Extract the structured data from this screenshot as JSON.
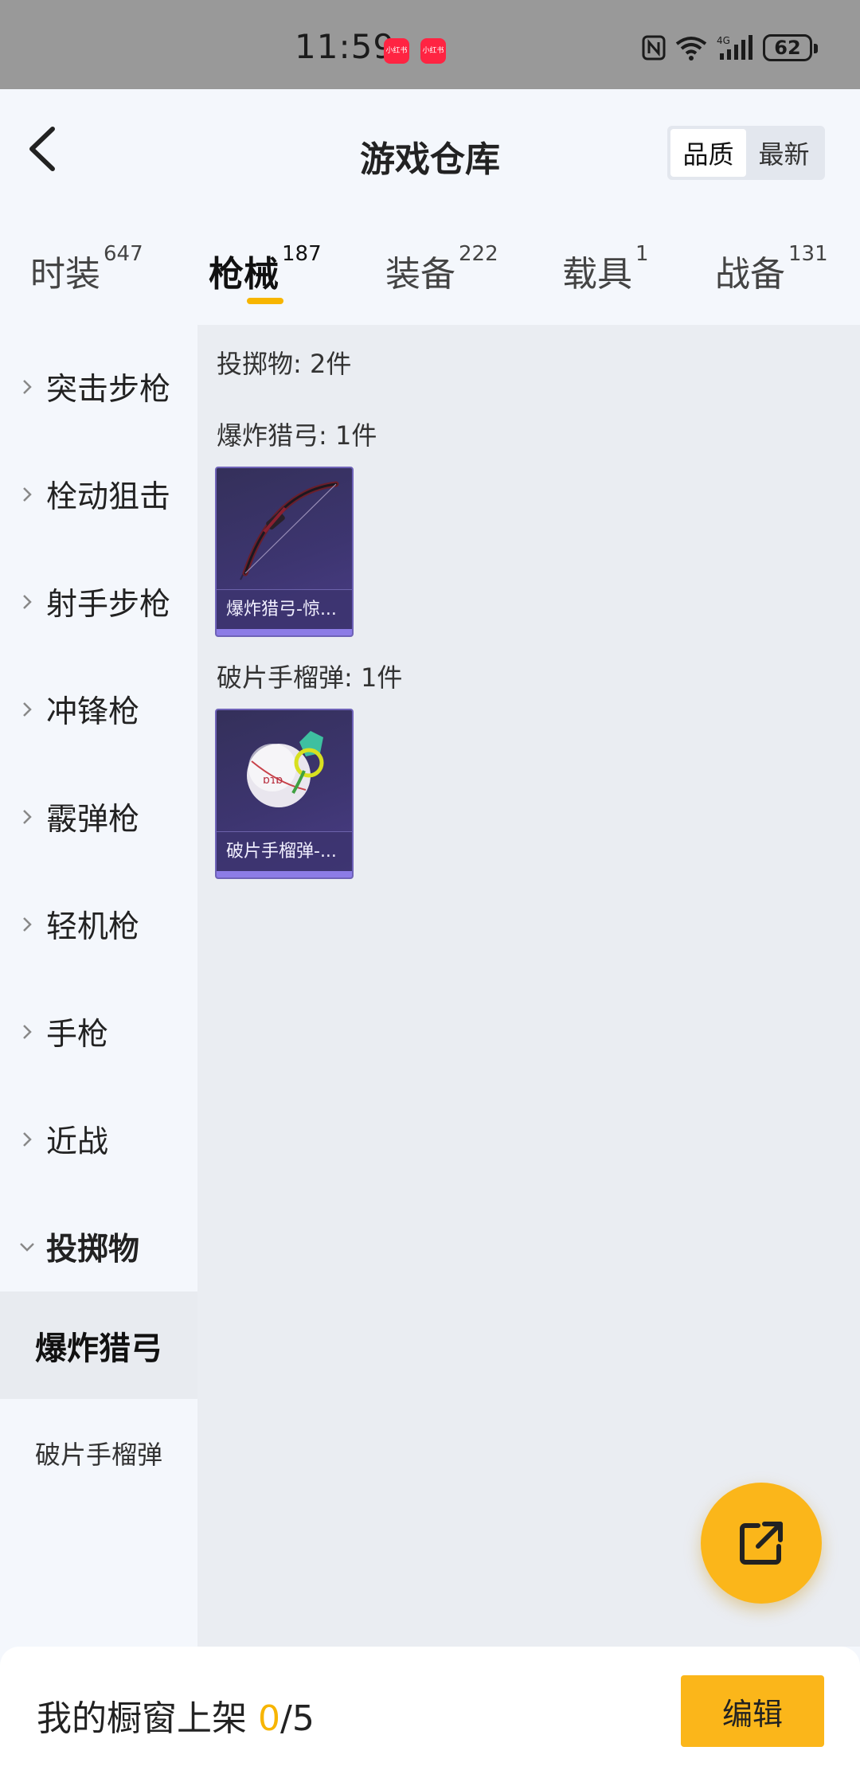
{
  "status_bar": {
    "time": "11:59",
    "notif_label_1": "小红书",
    "notif_label_2": "小红书",
    "battery": "62"
  },
  "header": {
    "title": "游戏仓库",
    "sort_options": [
      "品质",
      "最新"
    ],
    "active_sort": "品质"
  },
  "tabs": [
    {
      "label": "时装",
      "count": "647"
    },
    {
      "label": "枪械",
      "count": "187",
      "active": true
    },
    {
      "label": "装备",
      "count": "222"
    },
    {
      "label": "载具",
      "count": "1"
    },
    {
      "label": "战备",
      "count": "131"
    }
  ],
  "sidebar": {
    "categories": [
      "突击步枪",
      "栓动狙击",
      "射手步枪",
      "冲锋枪",
      "霰弹枪",
      "轻机枪",
      "手枪",
      "近战",
      "投掷物"
    ],
    "expanded_category": "投掷物",
    "sub_items": [
      "爆炸猎弓",
      "破片手榴弹"
    ],
    "selected_sub_item": "爆炸猎弓"
  },
  "content": {
    "summary": "投掷物: 2件",
    "groups": [
      {
        "label": "爆炸猎弓: 1件",
        "item_name": "爆炸猎弓-惊..."
      },
      {
        "label": "破片手榴弹: 1件",
        "item_name": "破片手榴弹-..."
      }
    ]
  },
  "bottom_bar": {
    "showcase_label": "我的橱窗上架 ",
    "showcase_current": "0",
    "showcase_total": "/5",
    "edit_label": "编辑"
  },
  "colors": {
    "accent": "#fbb61a",
    "underline": "#f7b500",
    "card_bg": "#3d3570"
  },
  "icons": {
    "back": "chevron-left-icon",
    "fab": "share-external-icon",
    "category": "chevron-right-icon",
    "expanded": "chevron-down-icon"
  }
}
